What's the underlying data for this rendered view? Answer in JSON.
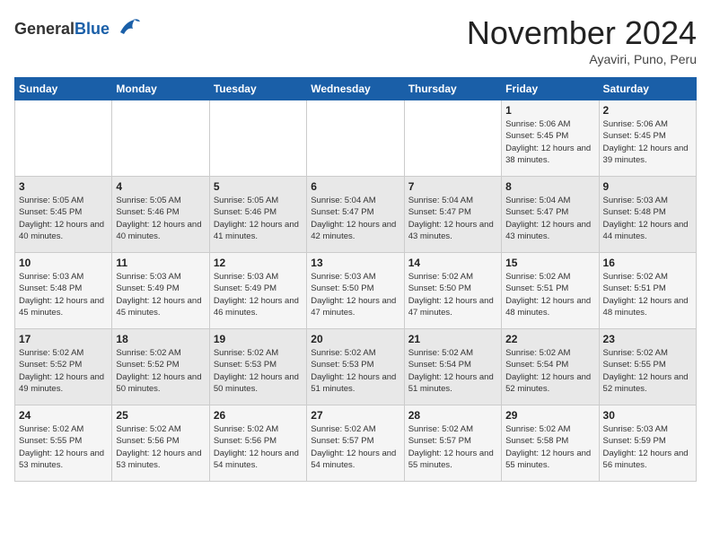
{
  "logo": {
    "general": "General",
    "blue": "Blue",
    "bird_symbol": "▶"
  },
  "header": {
    "month_year": "November 2024",
    "location": "Ayaviri, Puno, Peru"
  },
  "weekdays": [
    "Sunday",
    "Monday",
    "Tuesday",
    "Wednesday",
    "Thursday",
    "Friday",
    "Saturday"
  ],
  "weeks": [
    [
      {
        "day": "",
        "info": ""
      },
      {
        "day": "",
        "info": ""
      },
      {
        "day": "",
        "info": ""
      },
      {
        "day": "",
        "info": ""
      },
      {
        "day": "",
        "info": ""
      },
      {
        "day": "1",
        "info": "Sunrise: 5:06 AM\nSunset: 5:45 PM\nDaylight: 12 hours and 38 minutes."
      },
      {
        "day": "2",
        "info": "Sunrise: 5:06 AM\nSunset: 5:45 PM\nDaylight: 12 hours and 39 minutes."
      }
    ],
    [
      {
        "day": "3",
        "info": "Sunrise: 5:05 AM\nSunset: 5:45 PM\nDaylight: 12 hours and 40 minutes."
      },
      {
        "day": "4",
        "info": "Sunrise: 5:05 AM\nSunset: 5:46 PM\nDaylight: 12 hours and 40 minutes."
      },
      {
        "day": "5",
        "info": "Sunrise: 5:05 AM\nSunset: 5:46 PM\nDaylight: 12 hours and 41 minutes."
      },
      {
        "day": "6",
        "info": "Sunrise: 5:04 AM\nSunset: 5:47 PM\nDaylight: 12 hours and 42 minutes."
      },
      {
        "day": "7",
        "info": "Sunrise: 5:04 AM\nSunset: 5:47 PM\nDaylight: 12 hours and 43 minutes."
      },
      {
        "day": "8",
        "info": "Sunrise: 5:04 AM\nSunset: 5:47 PM\nDaylight: 12 hours and 43 minutes."
      },
      {
        "day": "9",
        "info": "Sunrise: 5:03 AM\nSunset: 5:48 PM\nDaylight: 12 hours and 44 minutes."
      }
    ],
    [
      {
        "day": "10",
        "info": "Sunrise: 5:03 AM\nSunset: 5:48 PM\nDaylight: 12 hours and 45 minutes."
      },
      {
        "day": "11",
        "info": "Sunrise: 5:03 AM\nSunset: 5:49 PM\nDaylight: 12 hours and 45 minutes."
      },
      {
        "day": "12",
        "info": "Sunrise: 5:03 AM\nSunset: 5:49 PM\nDaylight: 12 hours and 46 minutes."
      },
      {
        "day": "13",
        "info": "Sunrise: 5:03 AM\nSunset: 5:50 PM\nDaylight: 12 hours and 47 minutes."
      },
      {
        "day": "14",
        "info": "Sunrise: 5:02 AM\nSunset: 5:50 PM\nDaylight: 12 hours and 47 minutes."
      },
      {
        "day": "15",
        "info": "Sunrise: 5:02 AM\nSunset: 5:51 PM\nDaylight: 12 hours and 48 minutes."
      },
      {
        "day": "16",
        "info": "Sunrise: 5:02 AM\nSunset: 5:51 PM\nDaylight: 12 hours and 48 minutes."
      }
    ],
    [
      {
        "day": "17",
        "info": "Sunrise: 5:02 AM\nSunset: 5:52 PM\nDaylight: 12 hours and 49 minutes."
      },
      {
        "day": "18",
        "info": "Sunrise: 5:02 AM\nSunset: 5:52 PM\nDaylight: 12 hours and 50 minutes."
      },
      {
        "day": "19",
        "info": "Sunrise: 5:02 AM\nSunset: 5:53 PM\nDaylight: 12 hours and 50 minutes."
      },
      {
        "day": "20",
        "info": "Sunrise: 5:02 AM\nSunset: 5:53 PM\nDaylight: 12 hours and 51 minutes."
      },
      {
        "day": "21",
        "info": "Sunrise: 5:02 AM\nSunset: 5:54 PM\nDaylight: 12 hours and 51 minutes."
      },
      {
        "day": "22",
        "info": "Sunrise: 5:02 AM\nSunset: 5:54 PM\nDaylight: 12 hours and 52 minutes."
      },
      {
        "day": "23",
        "info": "Sunrise: 5:02 AM\nSunset: 5:55 PM\nDaylight: 12 hours and 52 minutes."
      }
    ],
    [
      {
        "day": "24",
        "info": "Sunrise: 5:02 AM\nSunset: 5:55 PM\nDaylight: 12 hours and 53 minutes."
      },
      {
        "day": "25",
        "info": "Sunrise: 5:02 AM\nSunset: 5:56 PM\nDaylight: 12 hours and 53 minutes."
      },
      {
        "day": "26",
        "info": "Sunrise: 5:02 AM\nSunset: 5:56 PM\nDaylight: 12 hours and 54 minutes."
      },
      {
        "day": "27",
        "info": "Sunrise: 5:02 AM\nSunset: 5:57 PM\nDaylight: 12 hours and 54 minutes."
      },
      {
        "day": "28",
        "info": "Sunrise: 5:02 AM\nSunset: 5:57 PM\nDaylight: 12 hours and 55 minutes."
      },
      {
        "day": "29",
        "info": "Sunrise: 5:02 AM\nSunset: 5:58 PM\nDaylight: 12 hours and 55 minutes."
      },
      {
        "day": "30",
        "info": "Sunrise: 5:03 AM\nSunset: 5:59 PM\nDaylight: 12 hours and 56 minutes."
      }
    ]
  ]
}
